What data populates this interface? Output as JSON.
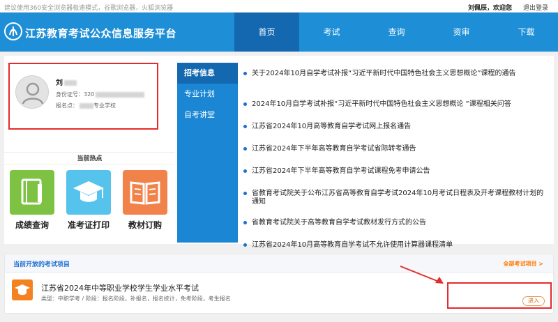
{
  "topbar": {
    "tip": "建议使用360安全浏览器极速模式，谷歌浏览器，火狐浏览器",
    "welcome": "刘佩辰，欢迎您",
    "logout": "退出登录"
  },
  "header": {
    "brand": "江苏教育考试公众信息服务平台",
    "nav": [
      "首页",
      "考试",
      "查询",
      "资审",
      "下载"
    ]
  },
  "user": {
    "name": "刘",
    "id_label": "身份证号：",
    "id_value": "320",
    "site_label": "报名点：",
    "site_value": "专业学校"
  },
  "hot": {
    "title": "当前热点",
    "tiles": [
      {
        "label": "成绩查询",
        "color": "#7dc242"
      },
      {
        "label": "准考证打印",
        "color": "#55c3ec"
      },
      {
        "label": "教材订购",
        "color": "#f0824a"
      }
    ]
  },
  "tabs": [
    "招考信息",
    "专业计划",
    "自考讲堂"
  ],
  "news": [
    "关于2024年10月自学考试补报“习近平新时代中国特色社会主义思想概论”课程的通告",
    "2024年10月自学考试补报“习近平新时代中国特色社会主义思想概论 ”课程相关问答",
    "江苏省2024年10月高等教育自学考试网上报名通告",
    "江苏省2024年下半年高等教育自学考试省际转考通告",
    "江苏省2024年下半年高等教育自学考试课程免考申请公告",
    "省教育考试院关于公布江苏省高等教育自学考试2024年10月考试日程表及开考课程教材计划的通知",
    "省教育考试院关于高等教育自学考试教材发行方式的公告",
    "江苏省2024年10月高等教育自学考试不允许使用计算器课程清单"
  ],
  "projects": {
    "title": "当前开放的考试项目",
    "all_link": "全部考试项目 >",
    "exam": {
      "name": "江苏省2024年中等职业学校学生学业水平考试",
      "meta": "类型：中职学考 / 阶段：报名阶段，补报名，报名统计，免考阶段，考生报名",
      "enter": "进入"
    }
  },
  "colors": {
    "header": "#1e8fd6",
    "nav_active": "#1468b0",
    "highlight": "#e52b2b",
    "accent_orange": "#ff7a00"
  }
}
